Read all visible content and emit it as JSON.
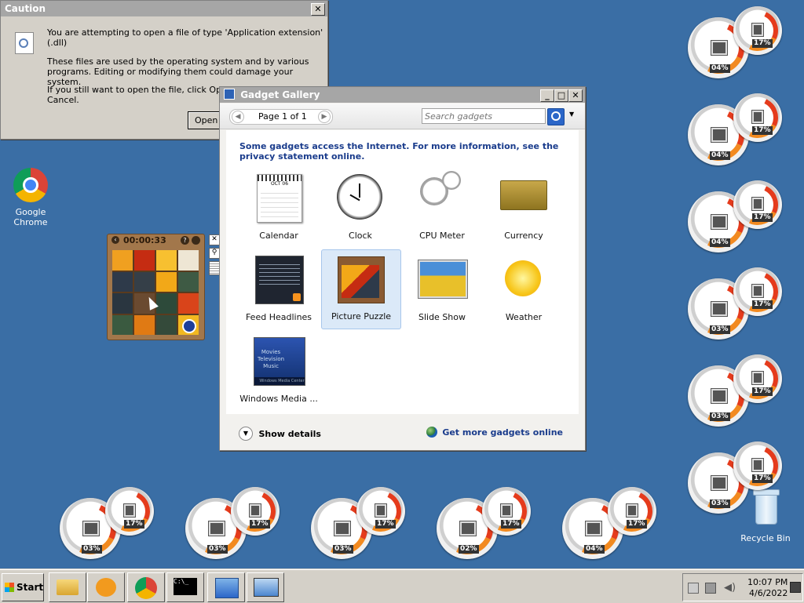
{
  "caution": {
    "title": "Caution",
    "line1": "You are attempting to open a file of type 'Application extension' (.dll)",
    "line2": "These files are used by the operating system and by various",
    "line3": "programs. Editing or modifying them could damage your system.",
    "line4": "If you still want to open the file, click Open wi",
    "line5": "Cancel.",
    "open_label": "Open"
  },
  "desktop": {
    "chrome_label": "Google Chrome",
    "recycle_label": "Recycle Bin"
  },
  "puzzle": {
    "timer": "00:00:33"
  },
  "gallery": {
    "title": "Gadget Gallery",
    "page": "Page 1 of 1",
    "search_placeholder": "Search gadgets",
    "info_line1": "Some gadgets access the Internet.  For more information, see the",
    "info_line2": "privacy statement online.",
    "calendar_month": "OCT 06",
    "gadgets": [
      "Calendar",
      "Clock",
      "CPU Meter",
      "Currency",
      "Feed Headlines",
      "Picture Puzzle",
      "Slide Show",
      "Weather",
      "Windows Media ..."
    ],
    "media_lines": [
      "Movies",
      "Television",
      "Music"
    ],
    "media_footer": "Windows Media Center",
    "show_details": "Show details",
    "get_more": "Get more gadgets online"
  },
  "meters": {
    "right_big": [
      "04%",
      "04%",
      "04%",
      "03%",
      "03%",
      "03%"
    ],
    "right_small": [
      "17%",
      "17%",
      "17%",
      "17%",
      "17%",
      "17%"
    ],
    "bottom_big": [
      "03%",
      "03%",
      "03%",
      "02%",
      "04%"
    ],
    "bottom_small": [
      "17%",
      "17%",
      "17%",
      "17%",
      "17%"
    ]
  },
  "taskbar": {
    "start_label": "Start",
    "time": "10:07 PM",
    "date": "4/6/2022"
  },
  "colors": {
    "desktop": "#3a6ea5",
    "accent": "#1a3c8c",
    "meter_red": "#e53b1c"
  }
}
